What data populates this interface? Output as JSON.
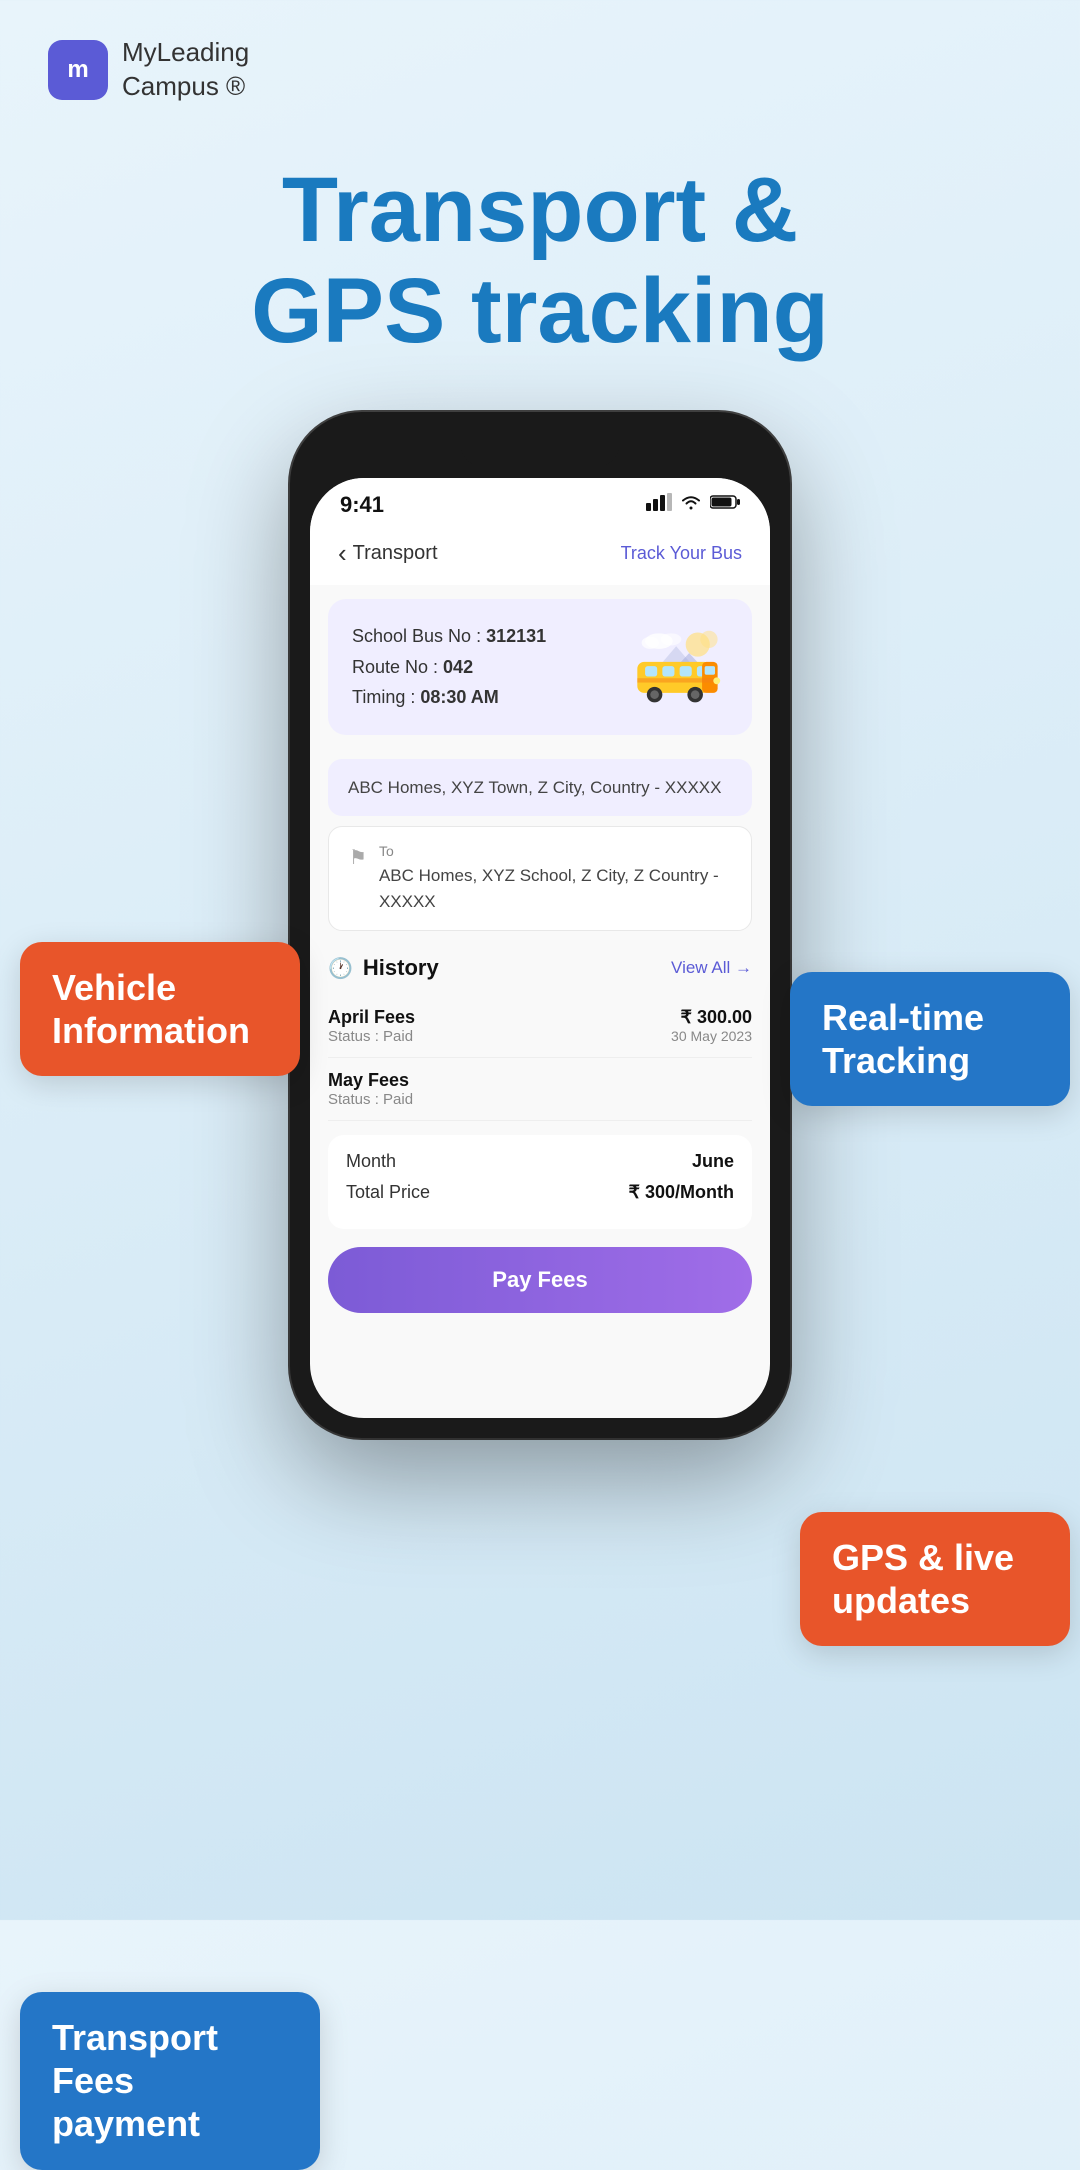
{
  "logo": {
    "icon_text": "m",
    "name_line1": "MyLeading",
    "name_line2": "Campus ®"
  },
  "heading": {
    "line1": "Transport &",
    "line2": "GPS tracking"
  },
  "phone": {
    "status_bar": {
      "time": "9:41",
      "signal": "▂▄▆",
      "wifi": "wifi",
      "battery": "🔋"
    },
    "header": {
      "back": "‹",
      "title": "Transport",
      "track_btn": "Track Your Bus"
    },
    "bus_card": {
      "bus_no_label": "School Bus No : ",
      "bus_no": "312131",
      "route_label": "Route No : ",
      "route_no": "042",
      "timing_label": "Timing : ",
      "timing": "08:30 AM"
    },
    "route": {
      "from_address": "ABC Homes, XYZ Town, Z City, Country - XXXXX",
      "to_label": "To",
      "to_address": "ABC Homes, XYZ School, Z City, Z Country - XXXXX"
    },
    "history": {
      "title": "History",
      "view_all": "View All →",
      "items": [
        {
          "name": "April Fees",
          "status": "Status : Paid",
          "amount": "₹ 300.00",
          "date": "30 May 2023"
        },
        {
          "name": "May Fees",
          "status": "Status : Paid",
          "amount": "",
          "date": ""
        }
      ]
    },
    "payment": {
      "month_label": "Month",
      "month_value": "June",
      "total_label": "Total Price",
      "total_value": "₹ 300/Month",
      "pay_button": "Pay Fees"
    }
  },
  "bubbles": {
    "vehicle": "Vehicle\nInformation",
    "realtime": "Real-time\nTracking",
    "gps": "GPS & live\nupdates",
    "fees": "Transport\nFees payment"
  }
}
